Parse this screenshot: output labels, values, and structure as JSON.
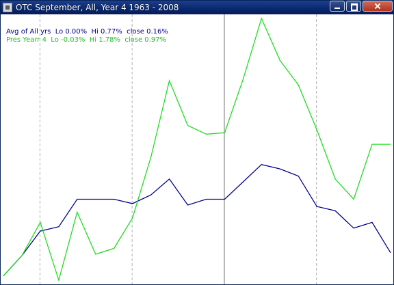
{
  "window": {
    "title": "OTC September,  All,  Year 4   1963 - 2008",
    "buttons": {
      "minimize": "minimize-icon",
      "maximize": "maximize-icon",
      "close": "close-icon"
    }
  },
  "chart_data": {
    "type": "line",
    "x": [
      1,
      2,
      3,
      4,
      5,
      6,
      7,
      8,
      9,
      10,
      11,
      12,
      13,
      14,
      15,
      16,
      17,
      18,
      19,
      20,
      21
    ],
    "ylim": [
      -0.03,
      1.78
    ],
    "grid": {
      "vertical_dashed_at": [
        2,
        7,
        17
      ],
      "vertical_solid_at": 12
    },
    "series": [
      {
        "name": "Avg of All yrs",
        "color": "#00008b",
        "values": [
          0.0,
          0.14,
          0.31,
          0.34,
          0.53,
          0.53,
          0.53,
          0.5,
          0.56,
          0.67,
          0.49,
          0.53,
          0.53,
          0.65,
          0.77,
          0.74,
          0.69,
          0.48,
          0.45,
          0.33,
          0.37,
          0.16
        ],
        "legend": {
          "label": "Avg of All yrs",
          "lo": "Lo 0.00%",
          "hi": "Hi 0.77%",
          "close": "close 0.16%"
        }
      },
      {
        "name": "Pres Yearr 4",
        "color": "#22dd22",
        "values": [
          0.0,
          0.14,
          0.37,
          -0.03,
          0.44,
          0.15,
          0.19,
          0.4,
          0.82,
          1.35,
          1.04,
          0.98,
          0.99,
          1.36,
          1.78,
          1.49,
          1.32,
          1.01,
          0.67,
          0.53,
          0.91,
          0.91
        ],
        "legend": {
          "label": "Pres Yearr 4",
          "lo": "Lo -0.03%",
          "hi": "Hi 1.78%",
          "close": "close 0.97%"
        }
      }
    ]
  }
}
